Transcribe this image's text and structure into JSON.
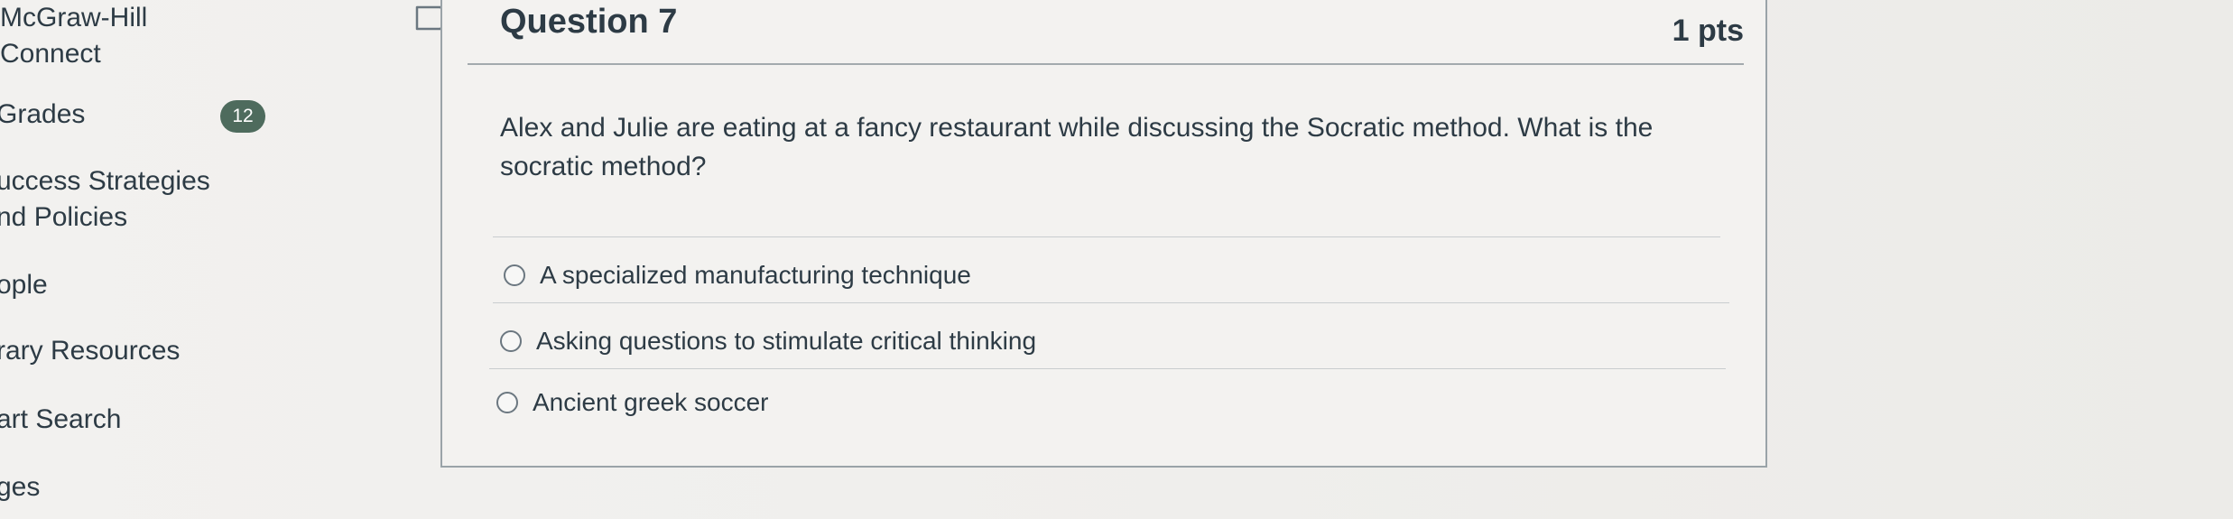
{
  "course_nav": {
    "mcgraw_line1": "McGraw-Hill",
    "mcgraw_line2": "Connect",
    "grades": "Grades",
    "grades_badge": "12",
    "success_line1": "uccess Strategies",
    "success_line2": "nd Policies",
    "people": "ople",
    "library": "rary Resources",
    "smart_search": "art Search",
    "pages": "ges"
  },
  "question": {
    "title": "Question 7",
    "points": "1 pts",
    "text": "Alex and Julie are eating at a fancy restaurant while discussing the Socratic method. What is the socratic method?",
    "answers": [
      {
        "label": "A specialized manufacturing technique",
        "selected": false
      },
      {
        "label": "Asking questions to stimulate critical thinking",
        "selected": false
      },
      {
        "label": "Ancient greek soccer",
        "selected": false
      }
    ]
  },
  "icons": {
    "bookmark": "bookmark-flag-icon"
  },
  "colors": {
    "badge_bg": "#4e6b5d",
    "text": "#2d3b45",
    "border": "#9aa3a8"
  }
}
